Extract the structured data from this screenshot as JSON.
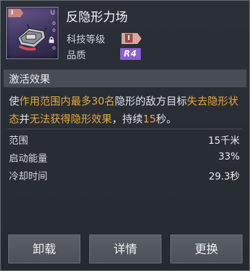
{
  "module": {
    "name": "反隐形力场",
    "tier_tag": "I",
    "u_mark": "U",
    "side_glyphs": [
      "o",
      "o",
      "o"
    ]
  },
  "meta": {
    "tech_level_label": "科技等级",
    "tech_level_value": "I",
    "quality_label": "品质",
    "quality_value": "R4"
  },
  "effect": {
    "section_title": "激活效果",
    "description_parts": [
      {
        "text": "使",
        "highlight": false
      },
      {
        "text": "作用范围内最多30名",
        "highlight": true
      },
      {
        "text": "隐形的敌方目标",
        "highlight": false
      },
      {
        "text": "失去隐形状态",
        "highlight": true
      },
      {
        "text": "并",
        "highlight": false
      },
      {
        "text": "无法获得隐形效果",
        "highlight": true
      },
      {
        "text": "，持续",
        "highlight": false
      },
      {
        "text": "15",
        "highlight": true
      },
      {
        "text": "秒。",
        "highlight": false
      }
    ]
  },
  "stats": [
    {
      "label": "范围",
      "value": "15千米"
    },
    {
      "label": "启动能量",
      "value": "33%"
    },
    {
      "label": "冷却时间",
      "value": "29.3秒"
    }
  ],
  "buttons": {
    "unload": "卸载",
    "details": "详情",
    "replace": "更换"
  },
  "colors": {
    "highlight": "#e6a93c",
    "quality_purple": "#8b5fd6",
    "tech_badge": "#d8a7a2"
  },
  "icons": [
    "module-device-icon",
    "lock-icon"
  ]
}
